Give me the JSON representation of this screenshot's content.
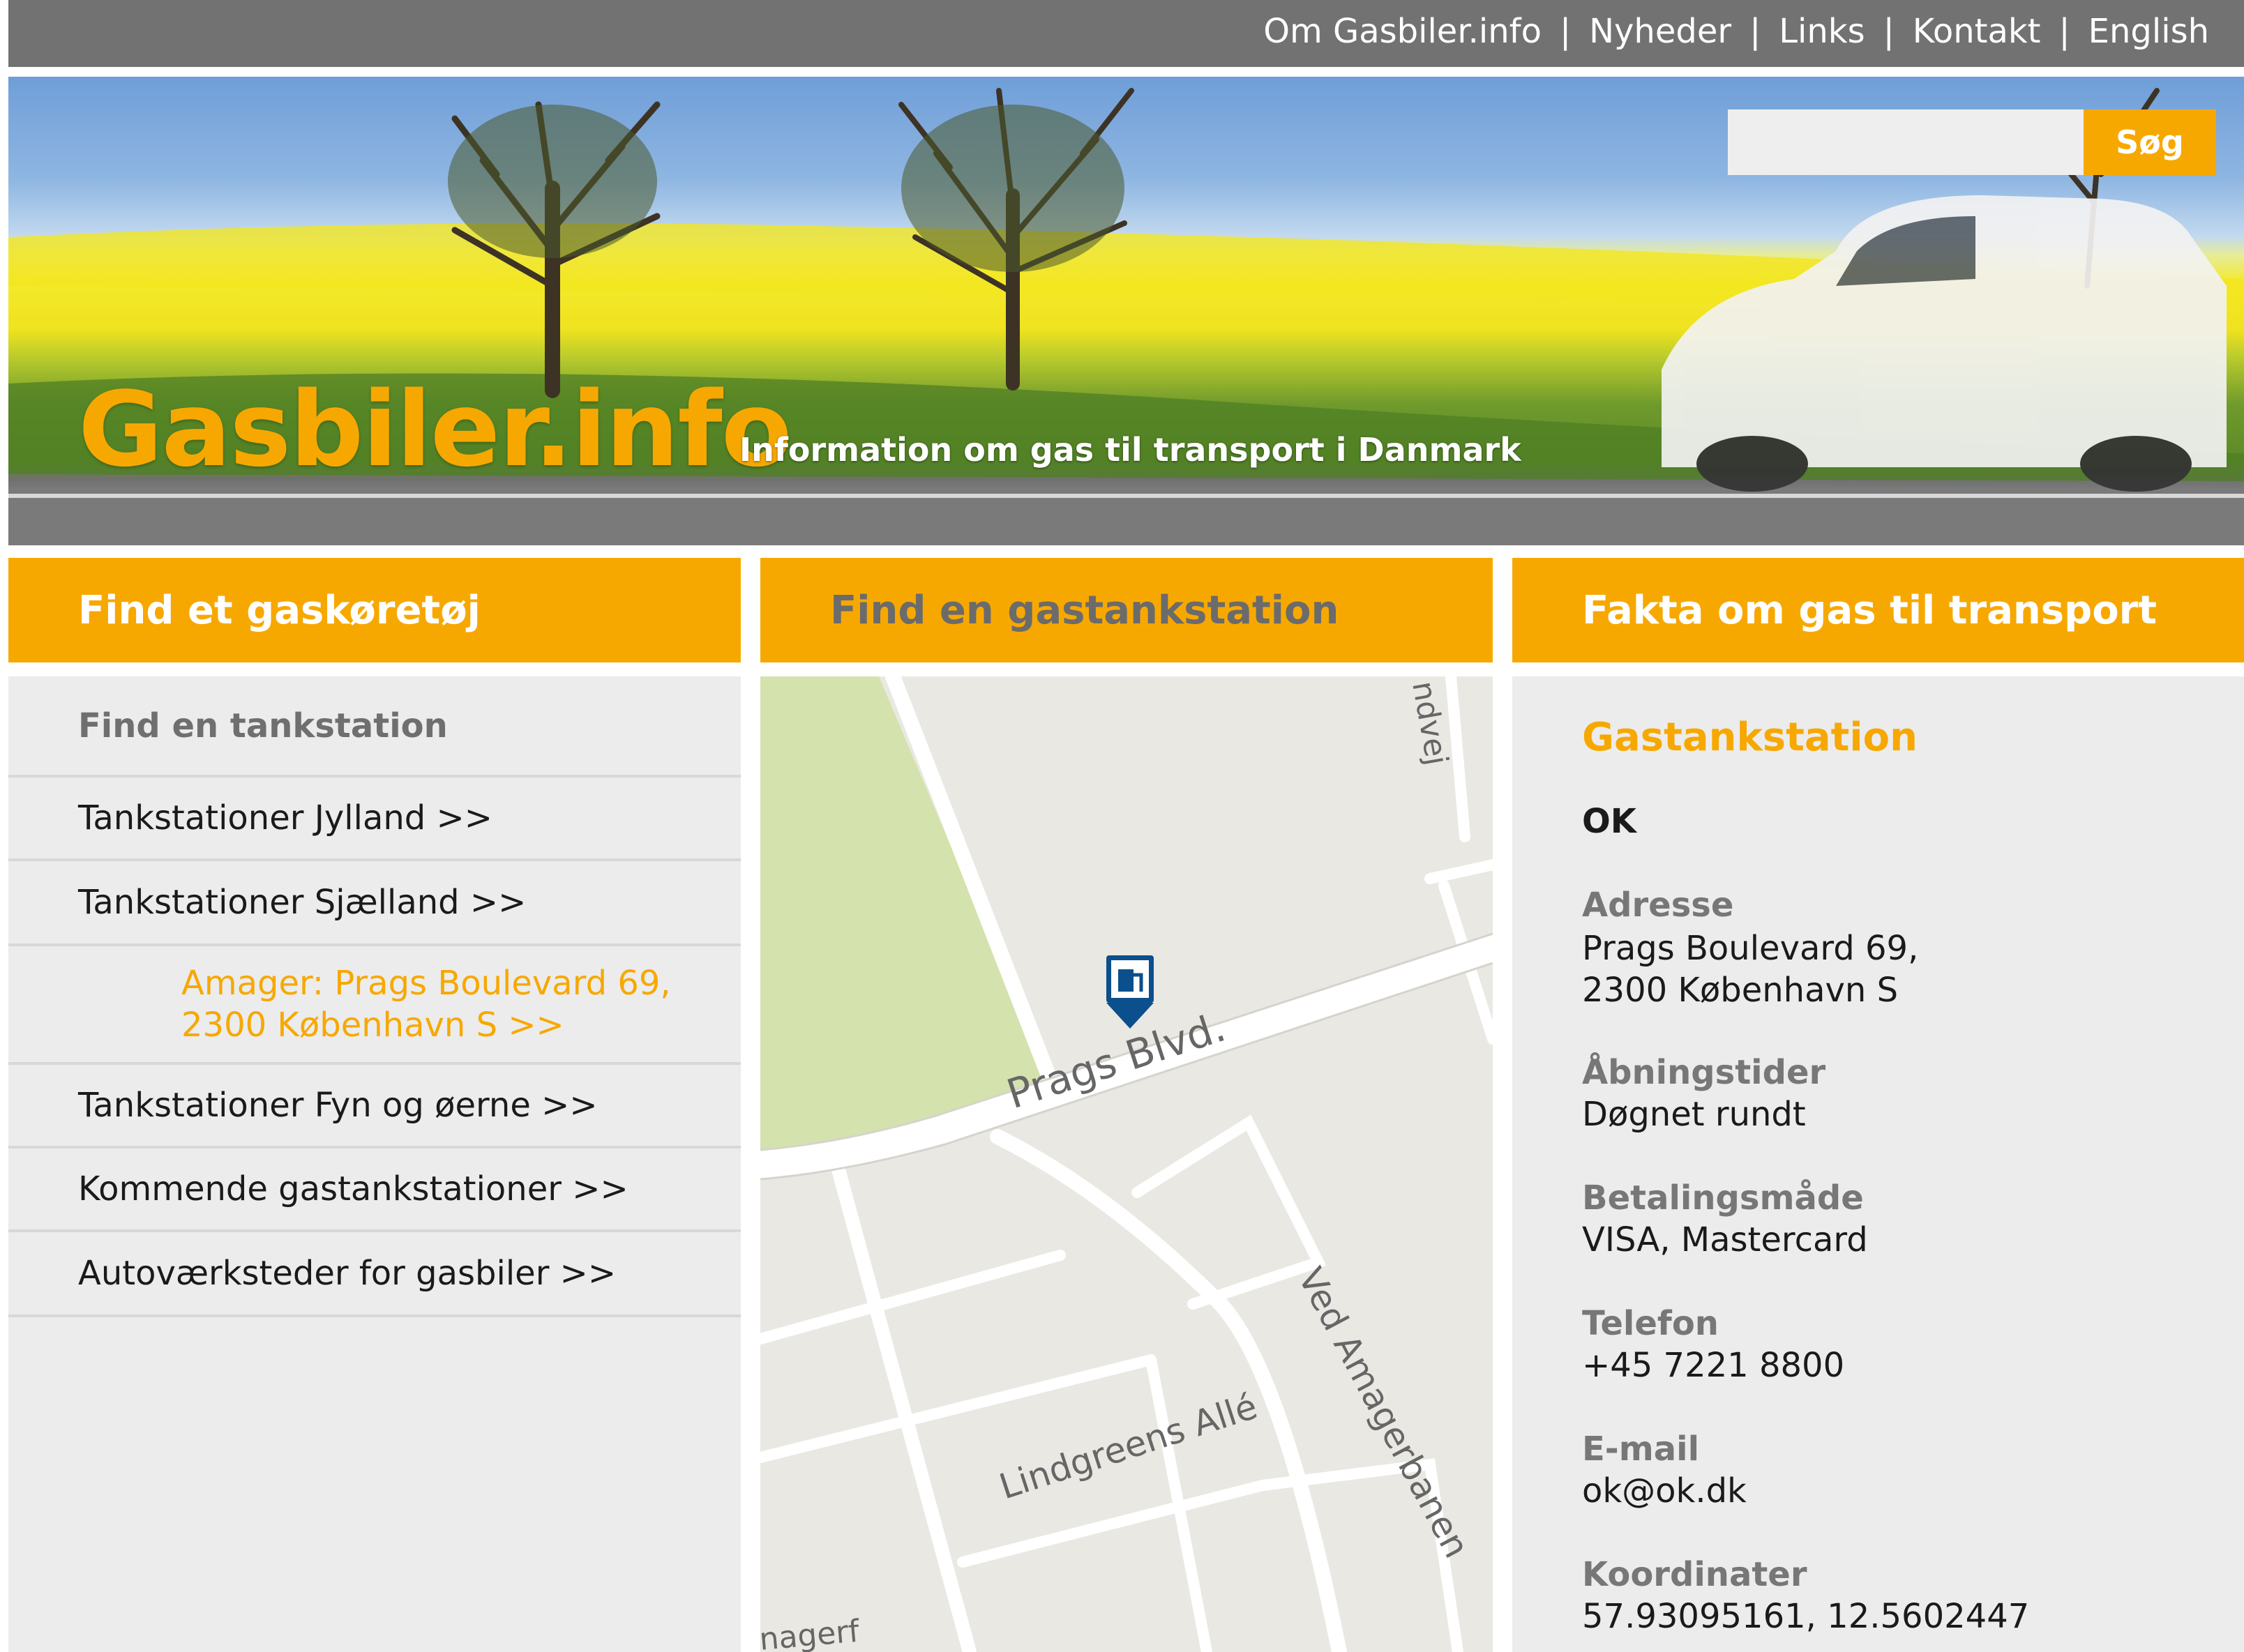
{
  "topnav": {
    "items": [
      "Om Gasbiler.info",
      "Nyheder",
      "Links",
      "Kontakt",
      "English"
    ],
    "separator": "|"
  },
  "hero": {
    "logo": "Gasbiler.info",
    "tagline": "Information om gas til transport i Danmark"
  },
  "search": {
    "placeholder": "",
    "button_label": "Søg"
  },
  "columns": {
    "vehicle": "Find et gaskøretøj",
    "station": "Find en gastankstation",
    "facts": "Fakta om gas til transport"
  },
  "sidebar": {
    "heading": "Find en tankstation",
    "items": [
      "Tankstationer Jylland >>",
      "Tankstationer Sjælland >>",
      "Amager: Prags Boulevard 69,",
      "2300 København S >>",
      "Tankstationer Fyn og øerne >>",
      "Kommende gastankstationer >>",
      "Autoværksteder for gasbiler >>"
    ]
  },
  "map": {
    "streets": [
      "Prags Blvd.",
      "Lindgreens Allé",
      "Ved Amagerbanen",
      "ndvej",
      "nagerf"
    ],
    "marker_icon": "gas-station-icon"
  },
  "station": {
    "title": "Gastankstation",
    "name": "OK",
    "address_label": "Adresse",
    "address_line1": "Prags Boulevard 69,",
    "address_line2": "2300 København S",
    "hours_label": "Åbningstider",
    "hours": "Døgnet rundt",
    "payment_label": "Betalingsmåde",
    "payment": "VISA, Mastercard",
    "phone_label": "Telefon",
    "phone": "+45 7221 8800",
    "email_label": "E-mail",
    "email": "ok@ok.dk",
    "coords_label": "Koordinater",
    "coords": "57.93095161, 12.5602447"
  },
  "colors": {
    "accent": "#f7a800",
    "topbar": "#727272",
    "panel": "#ececec"
  }
}
